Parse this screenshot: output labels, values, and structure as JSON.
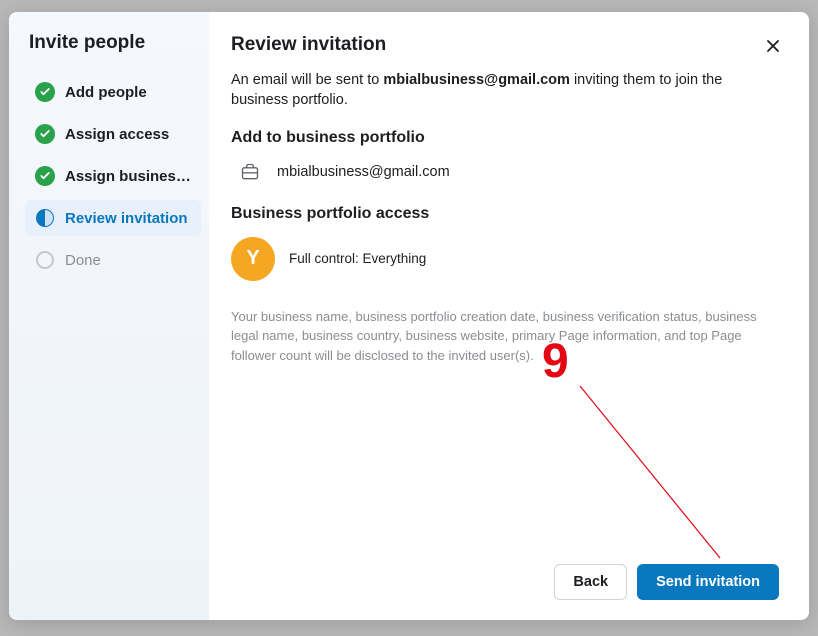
{
  "sidebar": {
    "title": "Invite people",
    "steps": [
      {
        "label": "Add people",
        "state": "done"
      },
      {
        "label": "Assign access",
        "state": "done"
      },
      {
        "label": "Assign business a...",
        "state": "done"
      },
      {
        "label": "Review invitation",
        "state": "active"
      },
      {
        "label": "Done",
        "state": "pending"
      }
    ]
  },
  "content": {
    "title": "Review invitation",
    "intro_prefix": "An email will be sent to ",
    "intro_email": "mbialbusiness@gmail.com",
    "intro_suffix": " inviting them to join the business portfolio.",
    "section_portfolio": "Add to business portfolio",
    "portfolio_email": "mbialbusiness@gmail.com",
    "section_access": "Business portfolio access",
    "avatar_letter": "Y",
    "access_text": "Full control: Everything",
    "disclosure": "Your business name, business portfolio creation date, business verification status, business legal name, business country, business website, primary Page information, and top Page follower count will be disclosed to the invited user(s)."
  },
  "footer": {
    "back": "Back",
    "send": "Send invitation"
  },
  "annotation": {
    "number": "9"
  }
}
